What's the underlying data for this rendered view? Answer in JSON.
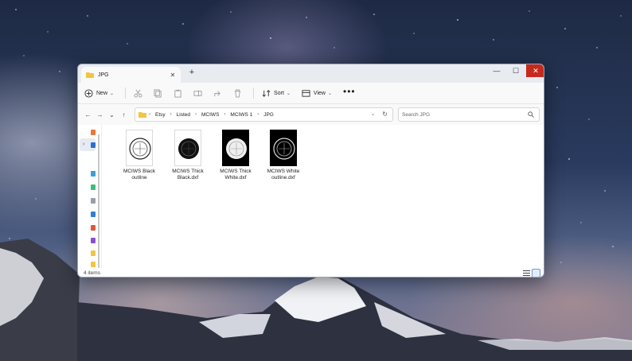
{
  "window": {
    "tab_title": "JPG",
    "new_tab_symbol": "+",
    "tab_close_symbol": "✕",
    "min_symbol": "—",
    "max_symbol": "☐",
    "close_symbol": "✕"
  },
  "toolbar": {
    "new_label": "New",
    "sort_label": "Sort",
    "view_label": "View",
    "more_symbol": "•••",
    "icons": [
      "cut-icon",
      "copy-icon",
      "paste-icon",
      "rename-icon",
      "share-icon",
      "delete-icon"
    ]
  },
  "nav": {
    "back_symbol": "←",
    "forward_symbol": "→",
    "recent_symbol": "⌄",
    "up_symbol": "↑",
    "expander_symbol": "›"
  },
  "address": {
    "crumbs": [
      "Etsy",
      "Listed",
      "MCIWS",
      "MCIWS 1",
      "JPG"
    ],
    "separator": "›",
    "dropdown_symbol": "⌄",
    "refresh_symbol": "↻"
  },
  "search": {
    "placeholder": "Search JPG"
  },
  "files": [
    {
      "name_line1": "MCIWS Black",
      "name_line2": "outline",
      "style": "black-outline"
    },
    {
      "name_line1": "MCIWS Thick",
      "name_line2": "Black.dxf",
      "style": "thick-black"
    },
    {
      "name_line1": "MCIWS Thick",
      "name_line2": "White.dxf",
      "style": "thick-white"
    },
    {
      "name_line1": "MCIWS White",
      "name_line2": "outline.dxf",
      "style": "white-outline"
    }
  ],
  "status": {
    "item_count": "4 items"
  },
  "colors": {
    "close_button": "#c42b1c",
    "folder": "#f4c542",
    "window_bg": "#ffffff"
  }
}
